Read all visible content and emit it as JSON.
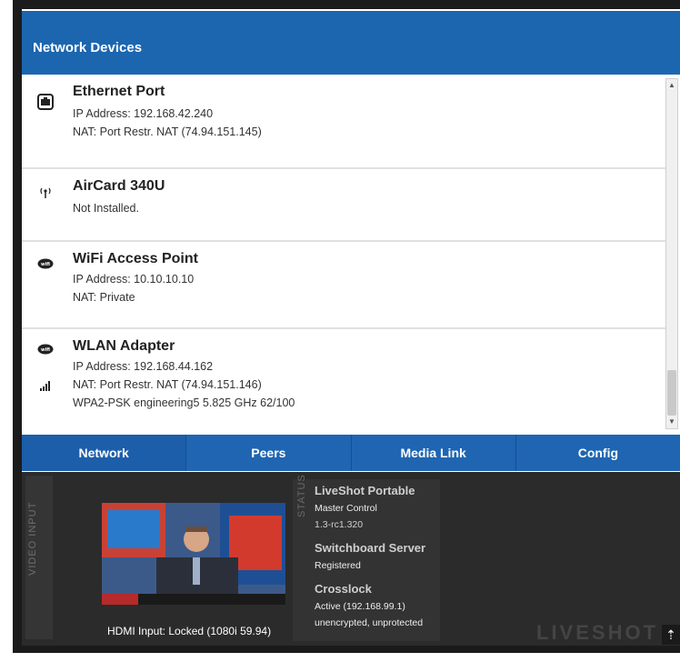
{
  "header": {
    "title": "Network Devices"
  },
  "devices": [
    {
      "name": "Ethernet Port",
      "icon": "ethernet-icon",
      "lines": [
        "IP Address: 192.168.42.240",
        "NAT: Port Restr. NAT (74.94.151.145)"
      ]
    },
    {
      "name": "AirCard 340U",
      "icon": "antenna-icon",
      "lines": [
        "Not Installed."
      ]
    },
    {
      "name": "WiFi Access Point",
      "icon": "wifi-icon",
      "lines": [
        "IP Address: 10.10.10.10",
        "NAT: Private"
      ]
    },
    {
      "name": "WLAN Adapter",
      "icon": "wifi-icon",
      "signal_icon": "signal-bars-icon",
      "lines": [
        "IP Address: 192.168.44.162",
        "NAT: Port Restr. NAT (74.94.151.146)",
        "WPA2-PSK engineering5 5.825 GHz 62/100"
      ]
    }
  ],
  "tabs": [
    {
      "label": "Network",
      "active": true
    },
    {
      "label": "Peers",
      "active": false
    },
    {
      "label": "Media Link",
      "active": false
    },
    {
      "label": "Config",
      "active": false
    }
  ],
  "video": {
    "side_label": "VIDEO INPUT",
    "hdmi_status": "HDMI Input: Locked (1080i 59.94)"
  },
  "status": {
    "side_label": "STATUS",
    "app_title": "LiveShot Portable",
    "app_role": "Master Control",
    "app_version": "1.3-rc1.320",
    "server_title": "Switchboard Server",
    "server_status": "Registered",
    "crosslock_title": "Crosslock",
    "crosslock_status": "Active (192.168.99.1)",
    "crosslock_security": "unencrypted, unprotected"
  },
  "logo": {
    "text": "LIVESHOT"
  },
  "colors": {
    "header_blue": "#1c66b0",
    "tab_blue": "#1f65b2",
    "panel_dark": "#2b2b2b"
  }
}
